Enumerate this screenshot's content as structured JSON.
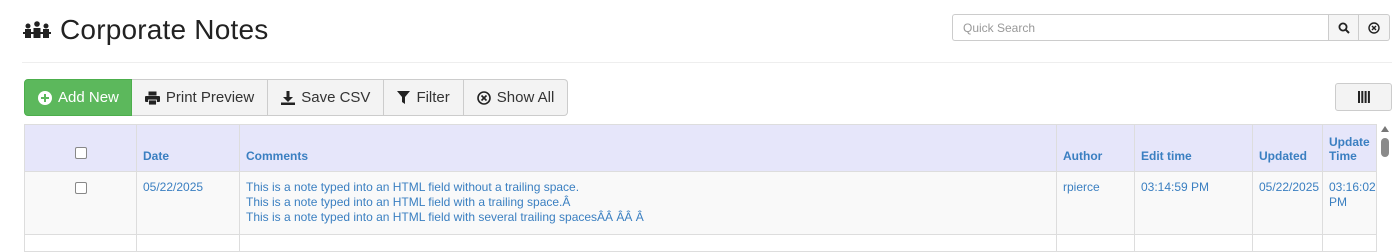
{
  "header": {
    "title": "Corporate Notes",
    "logo_icon": "people-icon"
  },
  "search": {
    "placeholder": "Quick Search",
    "value": "",
    "search_icon": "search-icon",
    "clear_icon": "clear-circle-icon"
  },
  "toolbar": {
    "add_new": "Add New",
    "print_preview": "Print Preview",
    "save_csv": "Save CSV",
    "filter": "Filter",
    "show_all": "Show All",
    "columns_icon": "columns-icon"
  },
  "colors": {
    "accent": "#3a7fc1",
    "primary_button": "#5cb85c",
    "header_bg": "#e6e6fa"
  },
  "table": {
    "columns": [
      "",
      "Date",
      "Comments",
      "Author",
      "Edit time",
      "Updated",
      "Update Time"
    ],
    "rows": [
      {
        "date": "05/22/2025",
        "comments": [
          "This is a note typed into an HTML field without a trailing space.",
          "This is a note typed into an HTML field with a trailing space.Â",
          "This is a note typed into an HTML field with several trailing spacesÂÂ ÂÂ Â"
        ],
        "author": "rpierce",
        "edit_time": "03:14:59 PM",
        "updated": "05/22/2025",
        "update_time": "03:16:02 PM"
      }
    ]
  }
}
